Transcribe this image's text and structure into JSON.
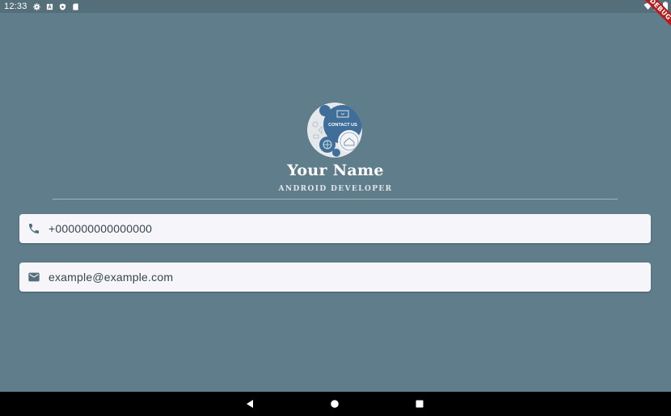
{
  "status_bar": {
    "time": "12:33",
    "icons": [
      "gear-icon",
      "notification-a-icon",
      "shield-icon",
      "sd-card-icon"
    ],
    "right_icons": [
      "wifi-icon",
      "signal-icon",
      "battery-icon"
    ]
  },
  "debug_banner": {
    "label": "DEBUG"
  },
  "profile": {
    "avatar_text": "CONTACT US",
    "name": "Your Name",
    "title": "ANDROID DEVELOPER"
  },
  "contacts": {
    "phone": {
      "icon": "phone-icon",
      "value": "+000000000000000"
    },
    "email": {
      "icon": "mail-icon",
      "value": "example@example.com"
    }
  },
  "navigation": {
    "buttons": [
      "back-icon",
      "home-icon",
      "recents-icon"
    ]
  },
  "colors": {
    "background": "#607D8B",
    "status_bar": "#546E7A",
    "card": "#F6F5FA",
    "card_text": "#37474F",
    "debug_ribbon": "#B71C1C"
  }
}
